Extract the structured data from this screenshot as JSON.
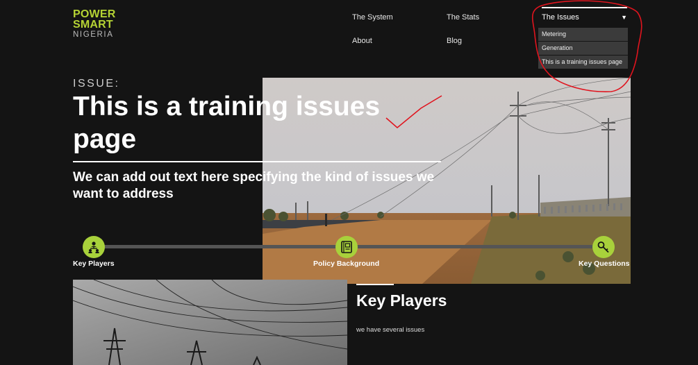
{
  "logo": {
    "line1": "POWER",
    "line2": "SMART",
    "line3": "NIGERIA"
  },
  "nav": {
    "system": "The System",
    "stats": "The Stats",
    "about": "About",
    "blog": "Blog",
    "issues": "The Issues",
    "issues_arrow": "▼"
  },
  "dropdown": {
    "items": [
      "Metering",
      "Generation",
      "This is a training issues page"
    ]
  },
  "hero": {
    "issue_label": "ISSUE:",
    "title": "This is a training issues page",
    "subtitle": "We can add out text here specifying the kind of issues we want to address"
  },
  "timeline": {
    "items": [
      {
        "label": "Key Players",
        "icon": "people-hierarchy-icon"
      },
      {
        "label": "Policy Background",
        "icon": "book-icon"
      },
      {
        "label": "Key Questions",
        "icon": "key-icon"
      }
    ]
  },
  "key_players": {
    "title": "Key Players",
    "text": "we have several issues"
  },
  "colors": {
    "accent": "#a8d13b",
    "background": "#141414",
    "annotation": "#e0141e"
  }
}
